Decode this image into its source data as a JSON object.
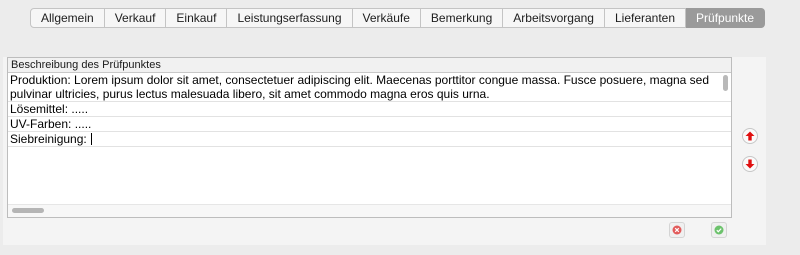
{
  "tabs": [
    {
      "label": "Allgemein"
    },
    {
      "label": "Verkauf"
    },
    {
      "label": "Einkauf"
    },
    {
      "label": "Leistungserfassung"
    },
    {
      "label": "Verkäufe"
    },
    {
      "label": "Bemerkung"
    },
    {
      "label": "Arbeitsvorgang"
    },
    {
      "label": "Lieferanten"
    },
    {
      "label": "Prüfpunkte",
      "active": true
    }
  ],
  "table": {
    "column_header": "Beschreibung des Prüfpunktes",
    "rows": [
      "Produktion: Lorem ipsum dolor sit amet, consectetuer adipiscing elit. Maecenas porttitor congue massa. Fusce posuere, magna sed pulvinar ultricies, purus lectus malesuada libero, sit amet commodo magna eros quis urna.",
      "Lösemittel: .....",
      "UV-Farben: .....",
      "Siebreinigung: "
    ]
  },
  "icons": {
    "move_up": "arrow-up-icon",
    "move_down": "arrow-down-icon",
    "delete": "delete-icon",
    "confirm": "confirm-icon"
  },
  "colors": {
    "active_tab_bg": "#9a9a9a",
    "arrow_red": "#e01010",
    "delete_red": "#e25b5b",
    "confirm_green": "#6cc26c"
  }
}
